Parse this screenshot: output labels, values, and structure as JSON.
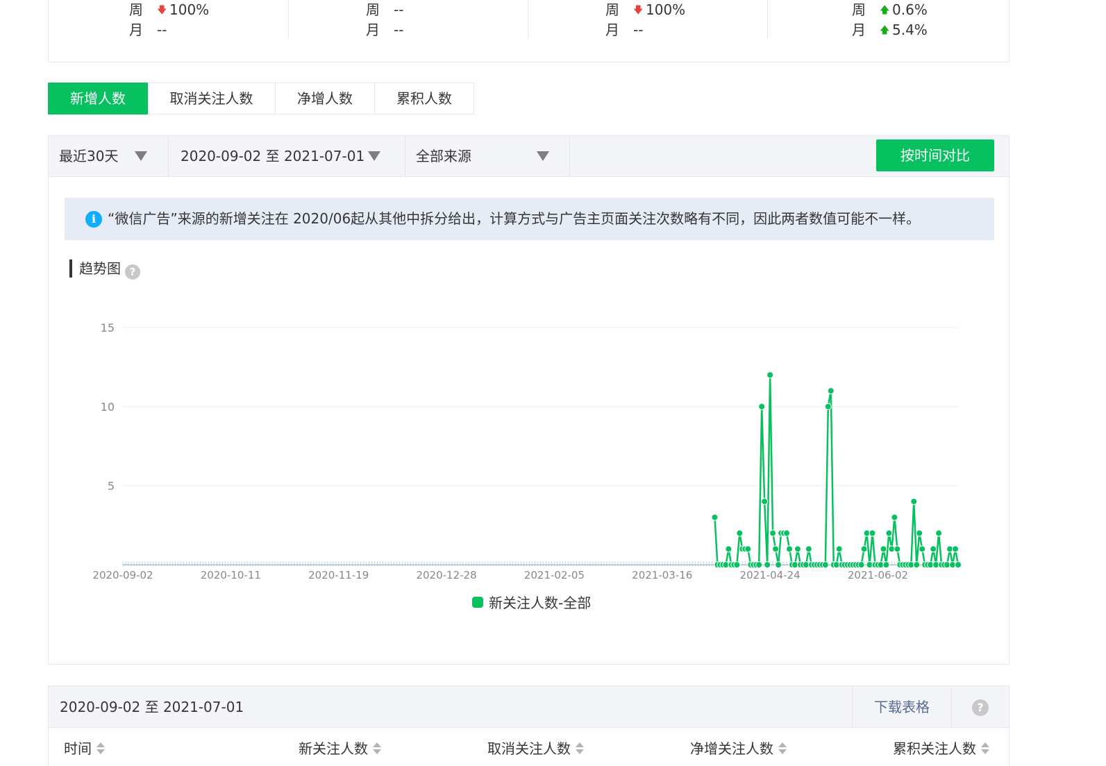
{
  "stats": [
    {
      "week_label": "周",
      "week_dir": "down",
      "week_value": "100%",
      "month_label": "月",
      "month_dir": "",
      "month_value": "--"
    },
    {
      "week_label": "周",
      "week_dir": "",
      "week_value": "--",
      "month_label": "月",
      "month_dir": "",
      "month_value": "--"
    },
    {
      "week_label": "周",
      "week_dir": "down",
      "week_value": "100%",
      "month_label": "月",
      "month_dir": "",
      "month_value": "--"
    },
    {
      "week_label": "周",
      "week_dir": "up",
      "week_value": "0.6%",
      "month_label": "月",
      "month_dir": "up",
      "month_value": "5.4%"
    }
  ],
  "tabs": [
    {
      "label": "新增人数",
      "active": true
    },
    {
      "label": "取消关注人数",
      "active": false
    },
    {
      "label": "净增人数",
      "active": false
    },
    {
      "label": "累积人数",
      "active": false
    }
  ],
  "filters": {
    "period": "最近30天",
    "date_range": "2020-09-02 至 2021-07-01",
    "source": "全部来源",
    "compare_button": "按时间对比"
  },
  "notice": {
    "text": "“微信广告”来源的新增关注在 2020/06起从其他中拆分给出，计算方式与广告主页面关注次数略有不同，因此两者数值可能不一样。"
  },
  "trend_title": "趋势图",
  "colors": {
    "accent": "#07c160",
    "down": "#e64340",
    "up": "#1aad19",
    "link": "#576b95",
    "info": "#10aeff"
  },
  "chart_data": {
    "type": "line",
    "x_start": "2020-09-02",
    "x_end": "2021-07-01",
    "x_ticks": [
      "2020-09-02",
      "2020-10-11",
      "2020-11-19",
      "2020-12-28",
      "2021-02-05",
      "2021-03-16",
      "2021-04-24",
      "2021-06-02"
    ],
    "ylim": [
      0,
      15
    ],
    "y_ticks": [
      5,
      10,
      15
    ],
    "grid": true,
    "legend_position": "bottom",
    "series": [
      {
        "name": "新关注人数-全部",
        "color": "#07c160",
        "points": [
          [
            "2021-04-04",
            3
          ],
          [
            "2021-04-05",
            0
          ],
          [
            "2021-04-06",
            0
          ],
          [
            "2021-04-07",
            0
          ],
          [
            "2021-04-08",
            0
          ],
          [
            "2021-04-09",
            1
          ],
          [
            "2021-04-10",
            0
          ],
          [
            "2021-04-11",
            0
          ],
          [
            "2021-04-12",
            0
          ],
          [
            "2021-04-13",
            2
          ],
          [
            "2021-04-14",
            1
          ],
          [
            "2021-04-15",
            1
          ],
          [
            "2021-04-16",
            1
          ],
          [
            "2021-04-17",
            0
          ],
          [
            "2021-04-18",
            0
          ],
          [
            "2021-04-19",
            0
          ],
          [
            "2021-04-20",
            0
          ],
          [
            "2021-04-21",
            10
          ],
          [
            "2021-04-22",
            4
          ],
          [
            "2021-04-23",
            0
          ],
          [
            "2021-04-24",
            12
          ],
          [
            "2021-04-25",
            2
          ],
          [
            "2021-04-26",
            1
          ],
          [
            "2021-04-27",
            0
          ],
          [
            "2021-04-28",
            2
          ],
          [
            "2021-04-29",
            2
          ],
          [
            "2021-04-30",
            2
          ],
          [
            "2021-05-01",
            1
          ],
          [
            "2021-05-02",
            0
          ],
          [
            "2021-05-03",
            0
          ],
          [
            "2021-05-04",
            1
          ],
          [
            "2021-05-05",
            0
          ],
          [
            "2021-05-06",
            0
          ],
          [
            "2021-05-07",
            0
          ],
          [
            "2021-05-08",
            1
          ],
          [
            "2021-05-09",
            0
          ],
          [
            "2021-05-10",
            0
          ],
          [
            "2021-05-11",
            0
          ],
          [
            "2021-05-12",
            0
          ],
          [
            "2021-05-13",
            0
          ],
          [
            "2021-05-14",
            0
          ],
          [
            "2021-05-15",
            10
          ],
          [
            "2021-05-16",
            11
          ],
          [
            "2021-05-17",
            0
          ],
          [
            "2021-05-18",
            0
          ],
          [
            "2021-05-19",
            1
          ],
          [
            "2021-05-20",
            0
          ],
          [
            "2021-05-21",
            0
          ],
          [
            "2021-05-22",
            0
          ],
          [
            "2021-05-23",
            0
          ],
          [
            "2021-05-24",
            0
          ],
          [
            "2021-05-25",
            0
          ],
          [
            "2021-05-26",
            0
          ],
          [
            "2021-05-27",
            0
          ],
          [
            "2021-05-28",
            1
          ],
          [
            "2021-05-29",
            2
          ],
          [
            "2021-05-30",
            0
          ],
          [
            "2021-05-31",
            2
          ],
          [
            "2021-06-01",
            0
          ],
          [
            "2021-06-02",
            0
          ],
          [
            "2021-06-03",
            0
          ],
          [
            "2021-06-04",
            1
          ],
          [
            "2021-06-05",
            0
          ],
          [
            "2021-06-06",
            2
          ],
          [
            "2021-06-07",
            1
          ],
          [
            "2021-06-08",
            3
          ],
          [
            "2021-06-09",
            1
          ],
          [
            "2021-06-10",
            0
          ],
          [
            "2021-06-11",
            0
          ],
          [
            "2021-06-12",
            0
          ],
          [
            "2021-06-13",
            0
          ],
          [
            "2021-06-14",
            0
          ],
          [
            "2021-06-15",
            4
          ],
          [
            "2021-06-16",
            0
          ],
          [
            "2021-06-17",
            2
          ],
          [
            "2021-06-18",
            1
          ],
          [
            "2021-06-19",
            0
          ],
          [
            "2021-06-20",
            0
          ],
          [
            "2021-06-21",
            0
          ],
          [
            "2021-06-22",
            1
          ],
          [
            "2021-06-23",
            0
          ],
          [
            "2021-06-24",
            2
          ],
          [
            "2021-06-25",
            0
          ],
          [
            "2021-06-26",
            0
          ],
          [
            "2021-06-27",
            0
          ],
          [
            "2021-06-28",
            1
          ],
          [
            "2021-06-29",
            0
          ],
          [
            "2021-06-30",
            1
          ],
          [
            "2021-07-01",
            0
          ]
        ]
      }
    ]
  },
  "table": {
    "range_label": "2020-09-02 至 2021-07-01",
    "download_label": "下载表格",
    "columns": [
      "时间",
      "新关注人数",
      "取消关注人数",
      "净增关注人数",
      "累积关注人数"
    ]
  }
}
